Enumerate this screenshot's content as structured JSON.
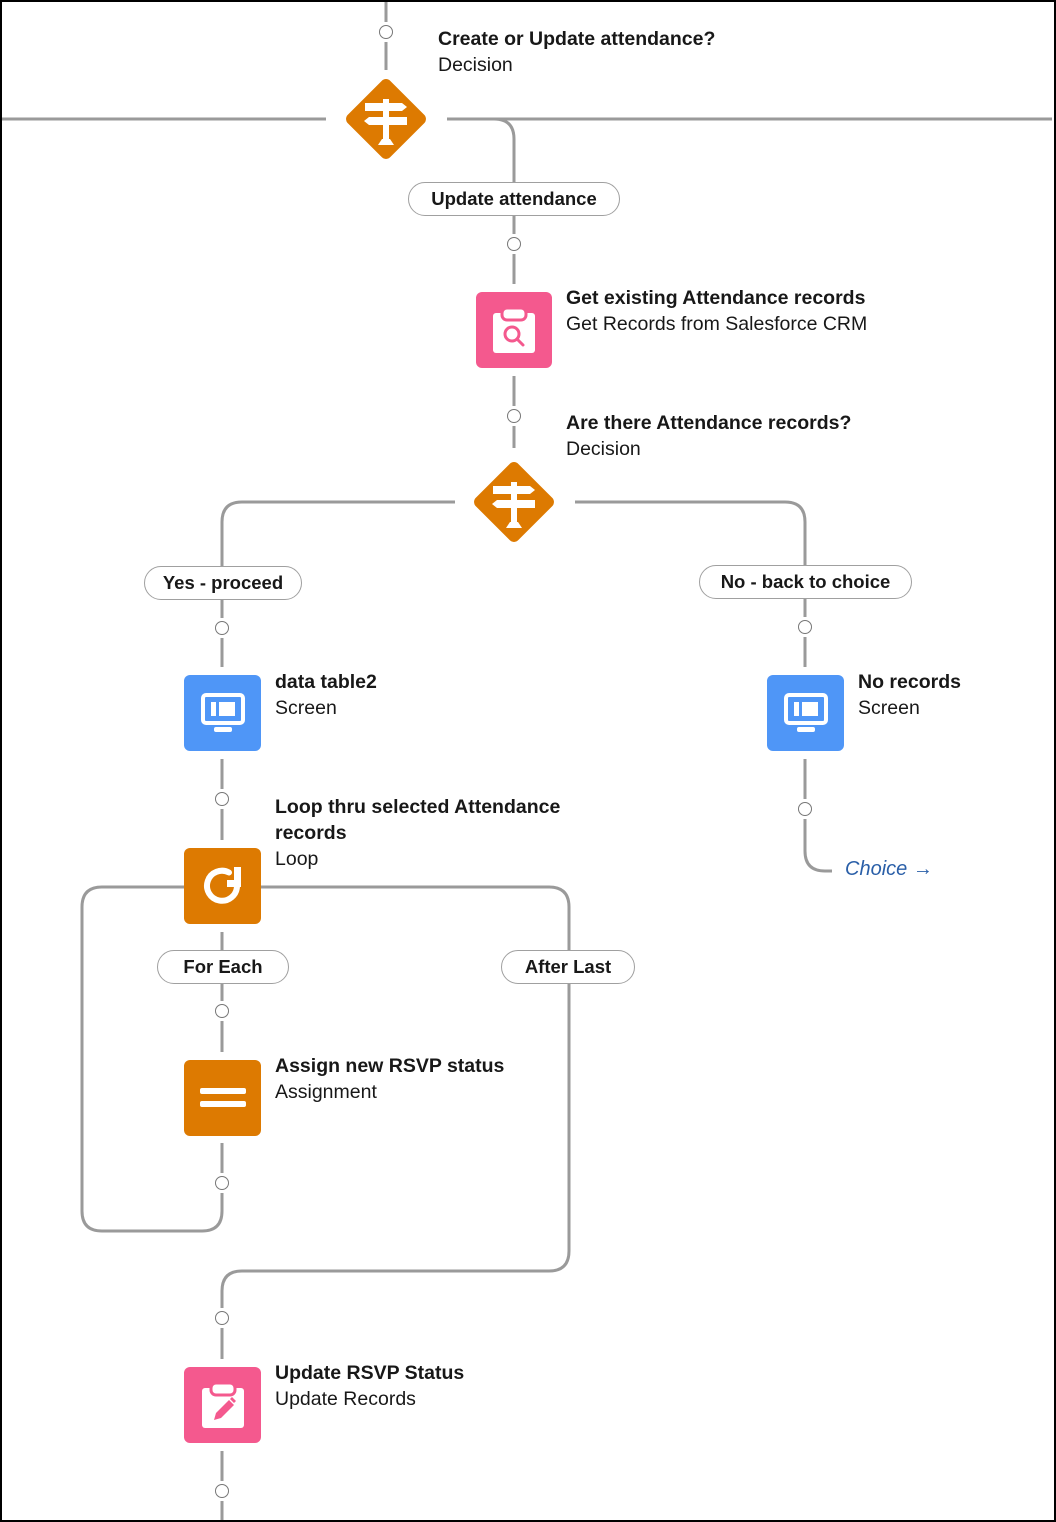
{
  "canvas": {
    "colors": {
      "connector": "#9a9a9a",
      "decision": "#dd7a01",
      "loop": "#dd7a01",
      "assignment": "#dd7a01",
      "record": "#f4598e",
      "screen": "#4f96f7",
      "goto_link": "#2a5fa8"
    }
  },
  "elements": {
    "decision_create_update": {
      "title": "Create or Update attendance?",
      "type": "Decision",
      "icon": "signpost-icon"
    },
    "get_records": {
      "title": "Get existing Attendance records",
      "type": "Get Records from Salesforce CRM",
      "icon": "clipboard-search-icon"
    },
    "decision_records_exist": {
      "title": "Are there Attendance records?",
      "type": "Decision",
      "icon": "signpost-icon"
    },
    "screen_data_table": {
      "title": "data table2",
      "type": "Screen",
      "icon": "monitor-icon"
    },
    "screen_no_records": {
      "title": "No records",
      "type": "Screen",
      "icon": "monitor-icon"
    },
    "loop": {
      "title_line1": "Loop thru selected Attendance",
      "title_line2": "records",
      "type": "Loop",
      "icon": "loop-arrow-icon"
    },
    "assignment": {
      "title": "Assign new RSVP status",
      "type": "Assignment",
      "icon": "equals-icon"
    },
    "update_records": {
      "title": "Update RSVP Status",
      "type": "Update Records",
      "icon": "clipboard-pencil-icon"
    }
  },
  "branches": {
    "update_attendance": "Update attendance",
    "yes_proceed": "Yes - proceed",
    "no_back": "No - back to choice",
    "for_each": "For Each",
    "after_last": "After Last"
  },
  "goto": {
    "label": "Choice →"
  }
}
